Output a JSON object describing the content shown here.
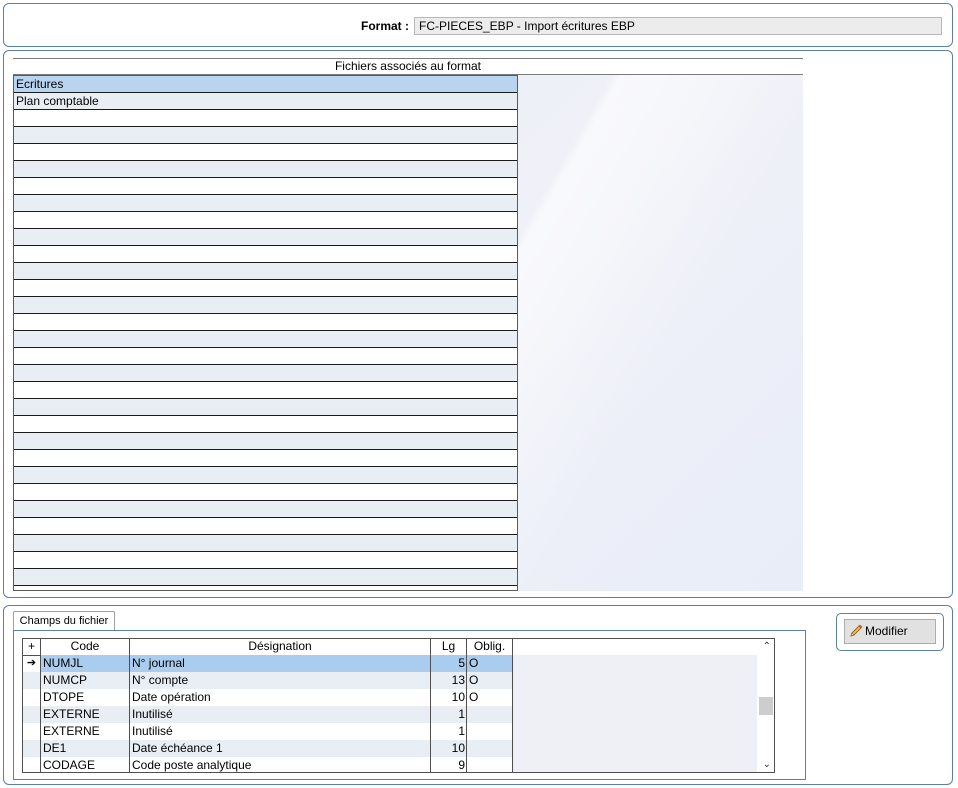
{
  "format": {
    "label": "Format :",
    "value": "FC-PIECES_EBP - Import écritures EBP"
  },
  "files": {
    "title": "Fichiers associés au format",
    "items": [
      "Ecritures",
      "Plan comptable"
    ],
    "selected_index": 0
  },
  "fields": {
    "tab_label": "Champs du fichier",
    "headers": {
      "code": "Code",
      "designation": "Désignation",
      "lg": "Lg",
      "oblig": "Oblig."
    },
    "rows": [
      {
        "code": "NUMJL",
        "designation": "N° journal",
        "lg": "5",
        "oblig": "O"
      },
      {
        "code": "NUMCP",
        "designation": "N° compte",
        "lg": "13",
        "oblig": "O"
      },
      {
        "code": "DTOPE",
        "designation": "Date opération",
        "lg": "10",
        "oblig": "O"
      },
      {
        "code": "EXTERNE",
        "designation": "Inutilisé",
        "lg": "1",
        "oblig": ""
      },
      {
        "code": "EXTERNE",
        "designation": "Inutilisé",
        "lg": "1",
        "oblig": ""
      },
      {
        "code": "DE1",
        "designation": "Date échéance 1",
        "lg": "10",
        "oblig": ""
      },
      {
        "code": "CODAGE",
        "designation": "Code poste analytique",
        "lg": "9",
        "oblig": ""
      }
    ],
    "current_row_marker": "➔",
    "add_column_symbol": "+"
  },
  "buttons": {
    "modifier": "Modifier"
  },
  "icons": {
    "pencil": "pencil-icon"
  },
  "colors": {
    "accent_border": "#5b7fa6",
    "selection": "#b9d4ef"
  }
}
